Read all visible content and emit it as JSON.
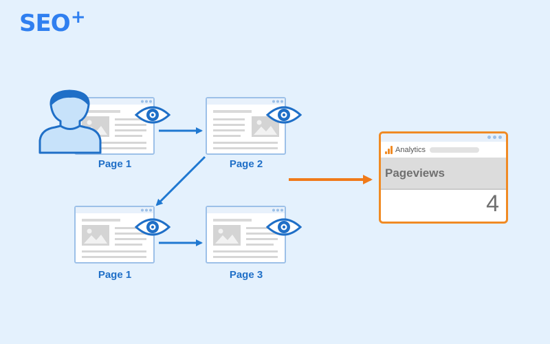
{
  "brand": {
    "logo_text": "SEO",
    "logo_superscript": "+"
  },
  "pages": [
    {
      "label": "Page 1"
    },
    {
      "label": "Page 2"
    },
    {
      "label": "Page 1"
    },
    {
      "label": "Page 3"
    }
  ],
  "analytics": {
    "title": "Analytics",
    "metric_label": "Pageviews",
    "metric_value": "4"
  },
  "colors": {
    "background": "#e4f1fd",
    "brand_blue": "#2f7ff0",
    "arrow_blue": "#1f78d1",
    "arrow_orange": "#f07a1a",
    "analytics_border": "#f08a23"
  },
  "icons": [
    "user-icon",
    "eye-icon",
    "image-placeholder-icon",
    "analytics-logo-icon"
  ]
}
